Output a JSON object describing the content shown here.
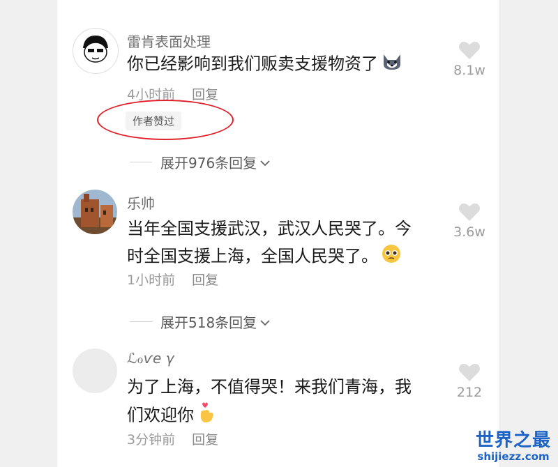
{
  "comments": [
    {
      "username": "雷肯表面处理",
      "text": "你已经影响到我们贩卖支援物资了",
      "time": "4小时前",
      "reply_label": "回复",
      "likes": "8.1w",
      "badge": "作者赞过",
      "expand": "展开976条回复",
      "emoji": "dog-emoji",
      "avatar_icon": "cartoon-avatar-icon"
    },
    {
      "username": "乐帅",
      "text_line1": "当年全国支援武汉，武汉人民哭了。今",
      "text_line2": "时全国支援上海，全国人民哭了。",
      "time": "1小时前",
      "reply_label": "回复",
      "likes": "3.6w",
      "expand": "展开518条回复",
      "emoji": "pleading-face-emoji",
      "avatar_icon": "building-photo-avatar"
    },
    {
      "username": "ℒℴѵe γ",
      "text_line1": "为了上海，不值得哭！来我们青海，我",
      "text_line2": "们欢迎你",
      "time": "3分钟前",
      "reply_label": "回复",
      "likes": "212",
      "emoji": "finger-heart-emoji",
      "avatar_icon": "blank-avatar"
    }
  ],
  "watermark": {
    "top": "世界之最",
    "bottom": "shijiezz.com"
  },
  "colors": {
    "highlight_ellipse": "#e0222b",
    "watermark": "#1d63c6"
  }
}
